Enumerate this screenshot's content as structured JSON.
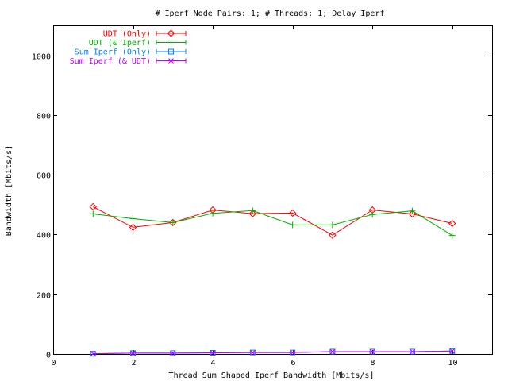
{
  "chart_data": {
    "type": "line",
    "title": "# Iperf Node Pairs: 1; # Threads: 1; Delay Iperf",
    "xlabel": "Thread Sum Shaped Iperf Bandwidth [Mbits/s]",
    "ylabel": "Bandwidth [Mbits/s]",
    "xlim": [
      0,
      11
    ],
    "ylim": [
      0,
      1100
    ],
    "xticks": [
      0,
      2,
      4,
      6,
      8,
      10
    ],
    "yticks": [
      0,
      200,
      400,
      600,
      800,
      1000
    ],
    "grid": false,
    "legend_position": "top-left",
    "series": [
      {
        "name": "UDT (Only)",
        "color": "#ff0000",
        "marker": "diamond",
        "x": [
          1,
          2,
          3,
          4,
          5,
          6,
          7,
          8,
          9,
          10
        ],
        "y": [
          493,
          424,
          440,
          482,
          470,
          472,
          398,
          482,
          469,
          437
        ]
      },
      {
        "name": "UDT (& Iperf)",
        "color": "#00b000",
        "marker": "plus",
        "x": [
          1,
          2,
          3,
          4,
          5,
          6,
          7,
          8,
          9,
          10
        ],
        "y": [
          469,
          453,
          440,
          471,
          480,
          432,
          432,
          467,
          479,
          397
        ]
      },
      {
        "name": "Sum Iperf (Only)",
        "color": "#0080ff",
        "marker": "square",
        "x": [
          1,
          2,
          3,
          4,
          5,
          6,
          7,
          8,
          9,
          10
        ],
        "y": [
          1,
          3,
          3,
          4,
          5,
          5,
          8,
          8,
          8,
          10
        ]
      },
      {
        "name": "Sum Iperf (& UDT)",
        "color": "#c000ff",
        "marker": "x",
        "x": [
          1,
          2,
          3,
          4,
          5,
          6,
          7,
          8,
          9,
          10
        ],
        "y": [
          1,
          3,
          3,
          4,
          5,
          5,
          8,
          8,
          8,
          10
        ]
      }
    ]
  }
}
